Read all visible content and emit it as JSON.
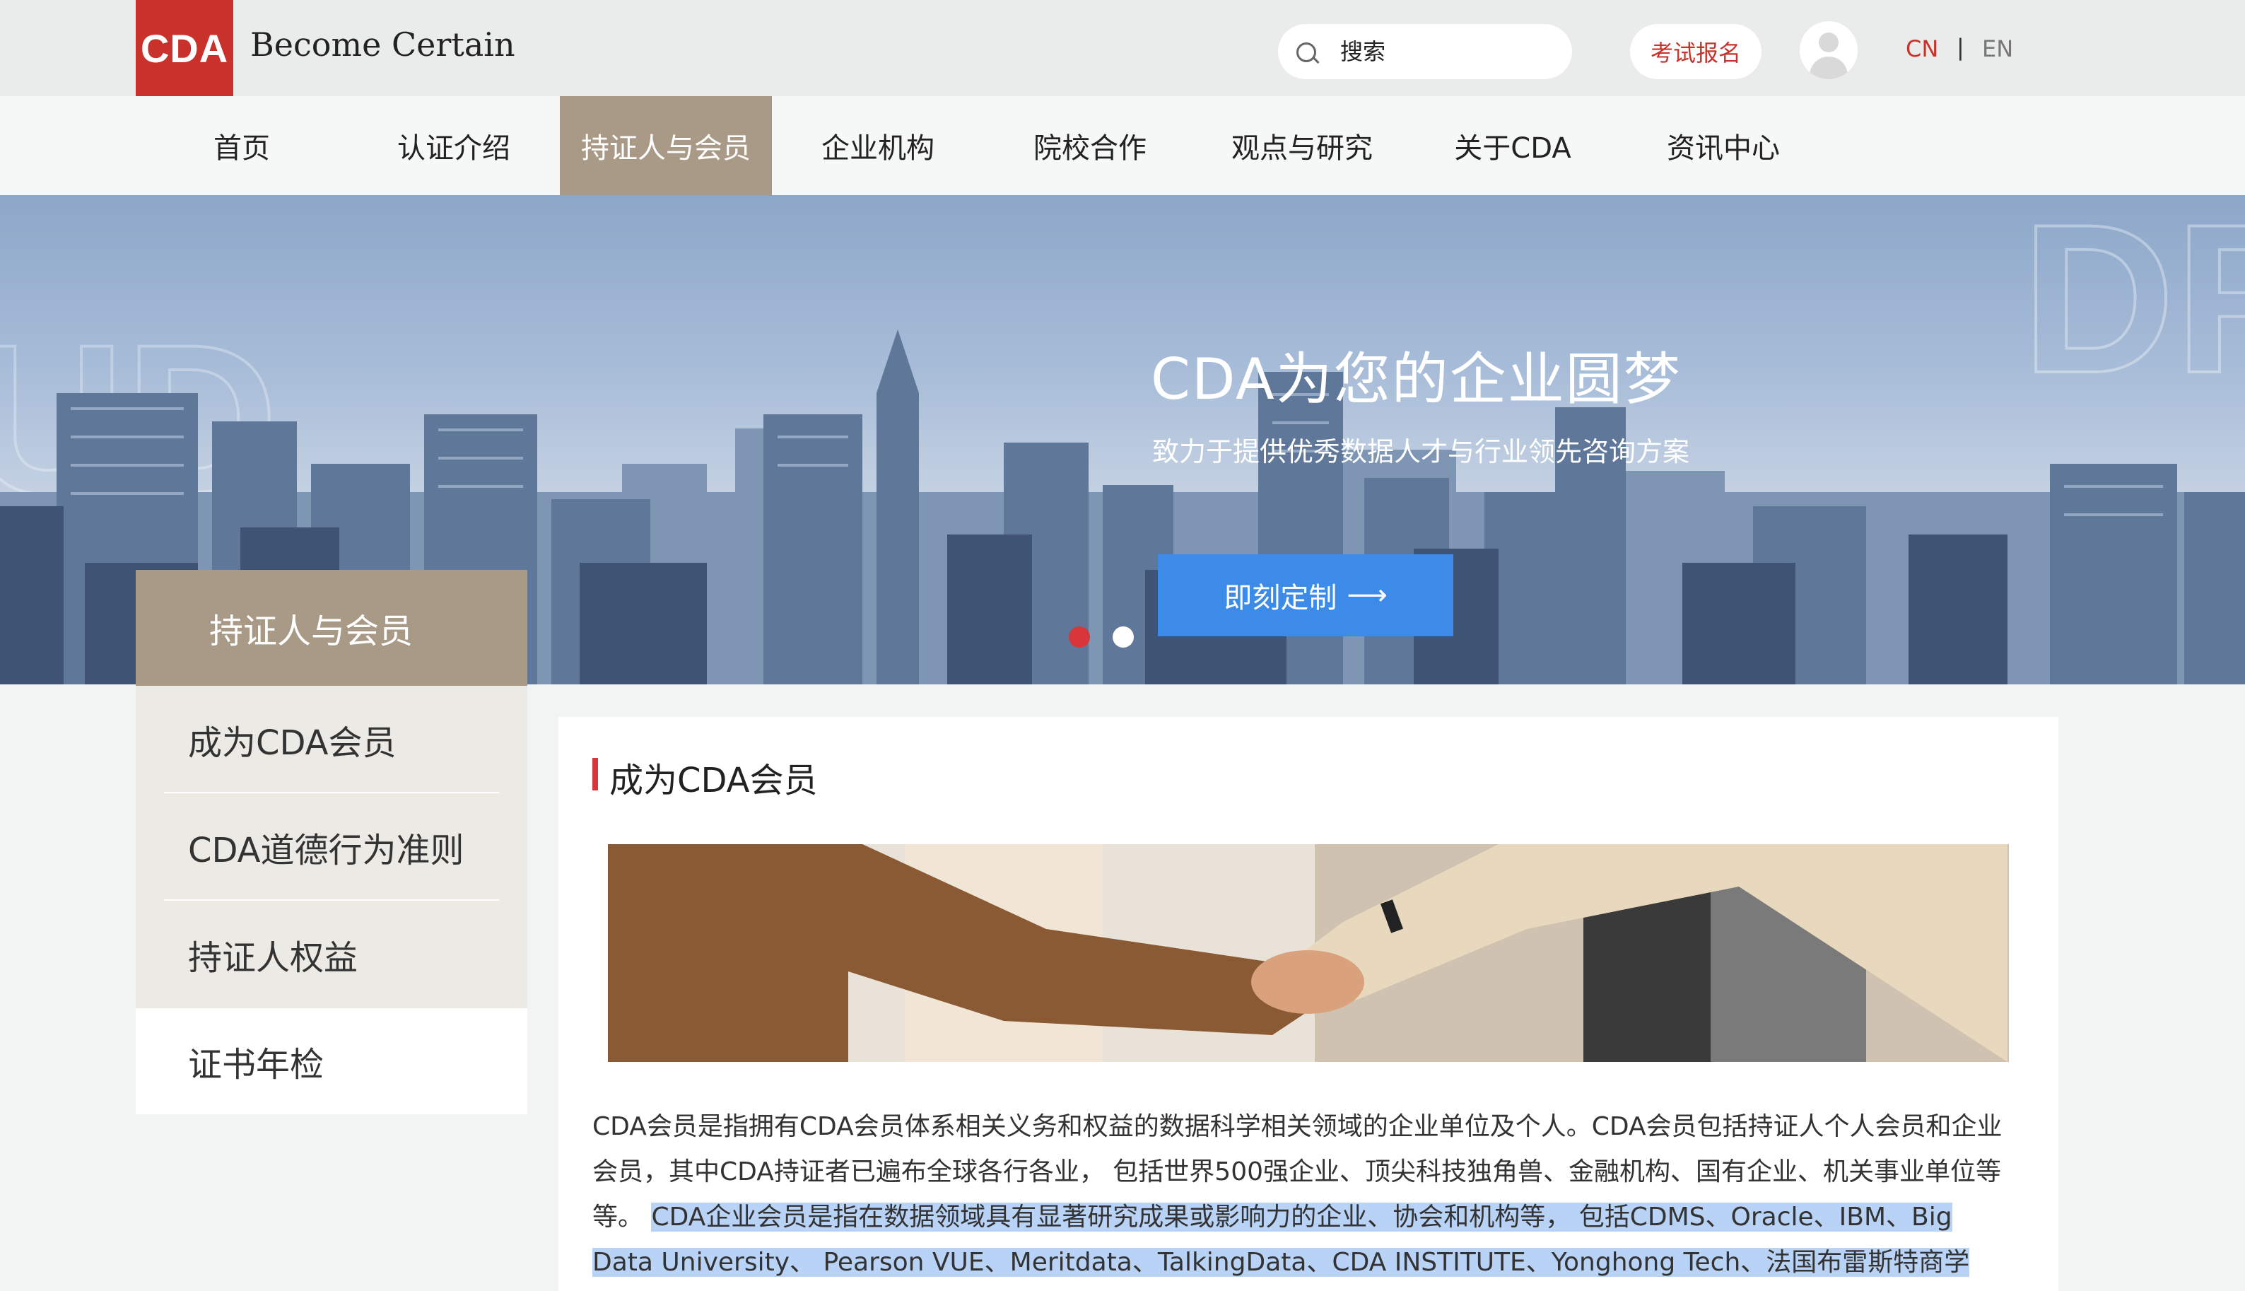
{
  "brand": {
    "logo": "CDA",
    "tagline": "Become Certain"
  },
  "header": {
    "search_placeholder": "搜索",
    "exam_button": "考试报名",
    "lang_cn": "CN",
    "lang_sep": "|",
    "lang_en": "EN"
  },
  "nav": {
    "items": [
      {
        "label": "首页"
      },
      {
        "label": "认证介绍"
      },
      {
        "label": "持证人与会员"
      },
      {
        "label": "企业机构"
      },
      {
        "label": "院校合作"
      },
      {
        "label": "观点与研究"
      },
      {
        "label": "关于CDA"
      },
      {
        "label": "资讯中心"
      }
    ],
    "active_index": 2
  },
  "banner": {
    "title": "CDA为您的企业圆梦",
    "subtitle": "致力于提供优秀数据人才与行业领先咨询方案",
    "cta_label": "即刻定制",
    "slides": 2,
    "active_slide": 1,
    "dot_active_color": "#d8363a"
  },
  "sidebar": {
    "heading": "持证人与会员",
    "items": [
      {
        "label": "成为CDA会员"
      },
      {
        "label": "CDA道德行为准则"
      },
      {
        "label": "持证人权益"
      },
      {
        "label": "证书年检"
      }
    ]
  },
  "content": {
    "section_title": "成为CDA会员",
    "para_normal": "CDA会员是指拥有CDA会员体系相关义务和权益的数据科学相关领域的企业单位及个人。CDA会员包括持证人个人会员和企业会员，其中CDA持证者已遍布全球各行各业，  包括世界500强企业、顶尖科技独角兽、金融机构、国有企业、机关事业单位等等。 ",
    "para_highlight": "CDA企业会员是指在数据领域具有显著研究成果或影响力的企业、协会和机构等，  包括CDMS、Oracle、IBM、Big Data University、 Pearson VUE、Meritdata、TalkingData、CDA INSTITUTE、Yonghong Tech、法国布雷斯特商学"
  },
  "colors": {
    "brand_red": "#c8322b",
    "nav_active": "#a99a87",
    "cta_blue": "#3d8be8",
    "selection": "#b9d3f7"
  }
}
